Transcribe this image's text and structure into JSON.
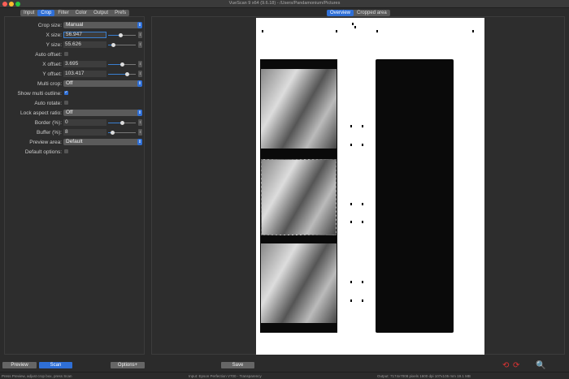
{
  "window": {
    "title": "VueScan 9 x64 (9.6.18) - /Users/Pandamonium/Pictures"
  },
  "tabs": [
    {
      "label": "Input"
    },
    {
      "label": "Crop",
      "active": true
    },
    {
      "label": "Filter"
    },
    {
      "label": "Color"
    },
    {
      "label": "Output"
    },
    {
      "label": "Prefs"
    }
  ],
  "crop": {
    "crop_size": {
      "label": "Crop size:",
      "value": "Manual"
    },
    "x_size": {
      "label": "X size:",
      "value": "56.947",
      "slider": 0.45
    },
    "y_size": {
      "label": "Y size:",
      "value": "55.626",
      "slider": 0.2
    },
    "auto_offset": {
      "label": "Auto offset:",
      "checked": false
    },
    "x_offset": {
      "label": "X offset:",
      "value": "3.695",
      "slider": 0.5
    },
    "y_offset": {
      "label": "Y offset:",
      "value": "103.417",
      "slider": 0.7
    },
    "multi_crop": {
      "label": "Multi crop:",
      "value": "Off"
    },
    "show_multi_outline": {
      "label": "Show multi outline:",
      "checked": true
    },
    "auto_rotate": {
      "label": "Auto rotate:",
      "checked": false
    },
    "lock_aspect_ratio": {
      "label": "Lock aspect ratio:",
      "value": "Off"
    },
    "border": {
      "label": "Border (%):",
      "value": "0",
      "slider": 0.5
    },
    "buffer": {
      "label": "Buffer (%):",
      "value": "8",
      "slider": 0.15
    },
    "preview_area": {
      "label": "Preview area:",
      "value": "Default"
    },
    "default_options": {
      "label": "Default options:",
      "checked": false
    }
  },
  "preview_tabs": [
    {
      "label": "Overview",
      "active": true
    },
    {
      "label": "Cropped area"
    }
  ],
  "buttons": {
    "preview": "Preview",
    "scan": "Scan",
    "options": "Options+",
    "save": "Save"
  },
  "status": {
    "left": "Press Preview, adjust crop box, press Scan",
    "middle": "Input: Epson Perfection V700 - Transparency",
    "right": "Output: 7174x7008 pixels 1600 dpi 107x105 mm 19.1 MB"
  },
  "colors": {
    "accent": "#2f6fd6",
    "background": "#2b2b2b"
  }
}
